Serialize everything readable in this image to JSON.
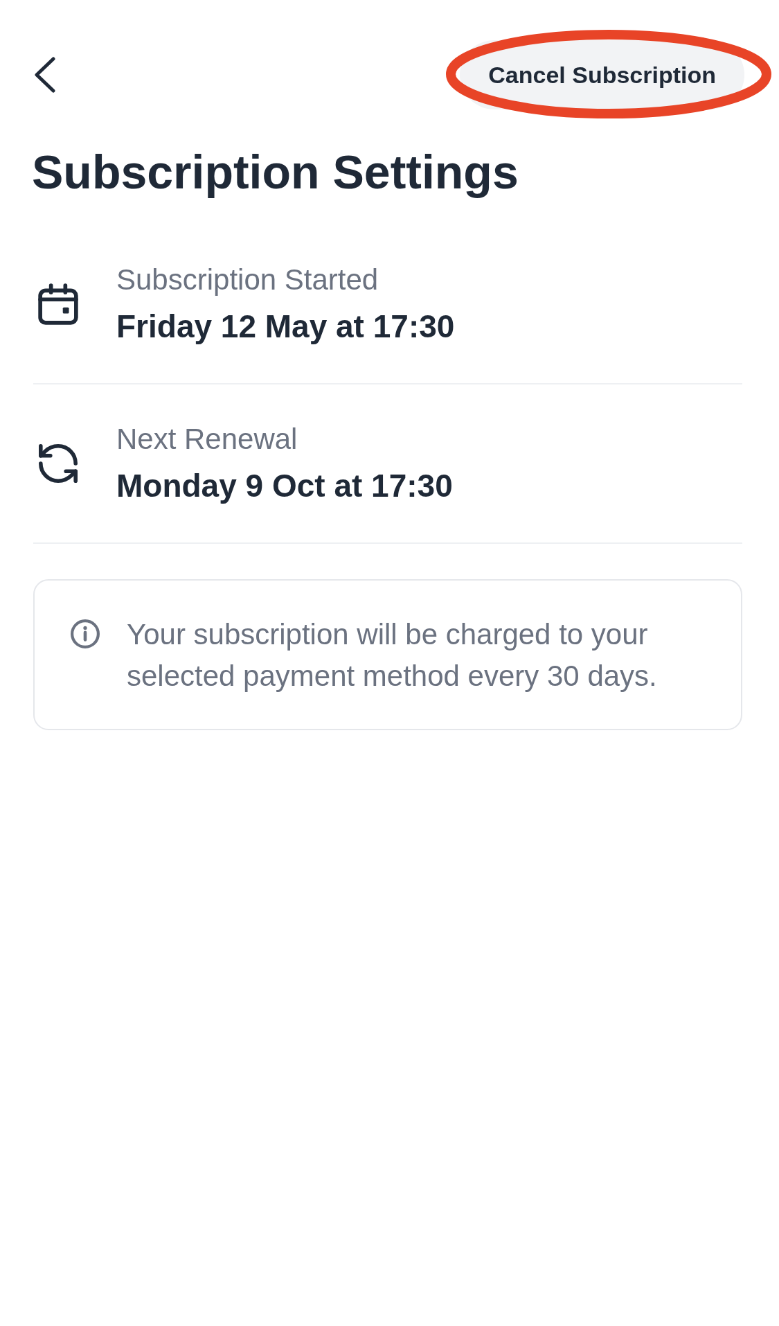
{
  "header": {
    "cancel_button": {
      "label": "Cancel Subscription",
      "highlighted": true
    }
  },
  "title": "Subscription Settings",
  "details": [
    {
      "kind": "calendar",
      "label": "Subscription Started",
      "value": "Friday 12 May at 17:30"
    },
    {
      "kind": "renewal",
      "label": "Next Renewal",
      "value": "Monday 9 Oct at 17:30"
    }
  ],
  "info_note": {
    "text": "Your subscription will be charged to your selected payment method every 30 days."
  }
}
